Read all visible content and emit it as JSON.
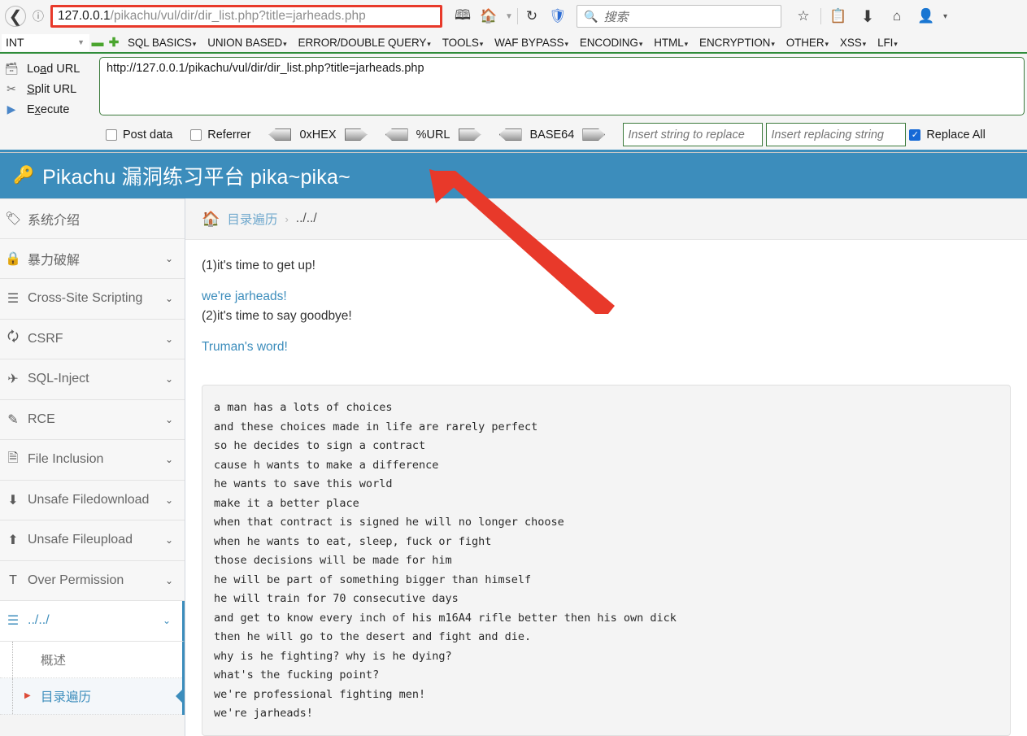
{
  "browser": {
    "back_icon": "back-arrow-icon",
    "info_icon": "page-info-icon",
    "url_host": "127.0.0.1",
    "url_path": "/pikachu/vul/dir/dir_list.php?title=jarheads.php",
    "reader_icon": "reader-view-icon",
    "home_icon": "home-icon",
    "dropdown_icon": "chevron-down-icon",
    "reload_icon": "reload-icon",
    "shield_icon": "tracking-protection-icon",
    "search_icon": "search-icon",
    "search_placeholder": "搜索",
    "bookmark_icon": "star-icon",
    "library_icon": "library-icon",
    "download_icon": "download-icon",
    "home2_icon": "home-page-icon",
    "account_icon": "account-avatar-icon",
    "account_caret": "caret-down-icon"
  },
  "hackbar": {
    "type_select": "INT",
    "minus_label": "–",
    "plus_label": "+",
    "menu": [
      "SQL BASICS",
      "UNION BASED",
      "ERROR/DOUBLE QUERY",
      "TOOLS",
      "WAF BYPASS",
      "ENCODING",
      "HTML",
      "ENCRYPTION",
      "OTHER",
      "XSS",
      "LFI"
    ],
    "actions": [
      {
        "label_pre": "Lo",
        "label_u": "a",
        "label_post": "d URL",
        "icon": "load-url-icon"
      },
      {
        "label_pre": "",
        "label_u": "S",
        "label_post": "plit URL",
        "icon": "split-url-icon"
      },
      {
        "label_pre": "E",
        "label_u": "x",
        "label_post": "ecute",
        "icon": "execute-icon"
      }
    ],
    "url_value": "http://127.0.0.1/pikachu/vul/dir/dir_list.php?title=jarheads.php",
    "post_data_label": "Post data",
    "referrer_label": "Referrer",
    "hex_label": "0xHEX",
    "url_encode_label": "%URL",
    "base64_label": "BASE64",
    "search_replace_placeholder": "Insert string to replace",
    "replacing_placeholder": "Insert replacing string",
    "replace_all_label": "Replace All"
  },
  "pikachu": {
    "logo_icon": "magnifier-key-icon",
    "title": "Pikachu 漏洞练习平台 pika~pika~",
    "header_color": "#3c8dbc",
    "sidebar": [
      {
        "label": "系统介绍",
        "icon": "tag-icon",
        "chevron": ""
      },
      {
        "label": "暴力破解",
        "icon": "lock-icon",
        "chevron": "⌄"
      },
      {
        "label": "Cross-Site Scripting",
        "icon": "xss-icon",
        "chevron": "⌄"
      },
      {
        "label": "CSRF",
        "icon": "external-link-icon",
        "chevron": "⌄"
      },
      {
        "label": "SQL-Inject",
        "icon": "plane-icon",
        "chevron": "⌄"
      },
      {
        "label": "RCE",
        "icon": "pencil-icon",
        "chevron": "⌄"
      },
      {
        "label": "File Inclusion",
        "icon": "file-icon",
        "chevron": "⌄"
      },
      {
        "label": "Unsafe Filedownload",
        "icon": "download-circle-icon",
        "chevron": "⌄"
      },
      {
        "label": "Unsafe Fileupload",
        "icon": "upload-circle-icon",
        "chevron": "⌄"
      },
      {
        "label": "Over Permission",
        "icon": "text-height-icon",
        "chevron": "⌄"
      },
      {
        "label": "../../",
        "icon": "list-icon",
        "chevron": "⌄"
      }
    ],
    "sidebar_sub": [
      {
        "label": "概述",
        "active": false
      },
      {
        "label": "目录遍历",
        "active": true
      }
    ],
    "breadcrumb": {
      "home_icon": "home-icon",
      "link": "目录遍历",
      "separator": "›",
      "current": "../../"
    },
    "content_lines": [
      {
        "text": "(1)it's time to get up!",
        "style": "plain"
      },
      {
        "text": "",
        "style": "gap"
      },
      {
        "text": "we're jarheads!",
        "style": "blue"
      },
      {
        "text": "(2)it's time to say goodbye!",
        "style": "plain"
      },
      {
        "text": "",
        "style": "gap"
      },
      {
        "text": "Truman's word!",
        "style": "blue"
      }
    ],
    "poem": "a man has a lots of choices\nand these choices made in life are rarely perfect\nso he decides to sign a contract\ncause h wants to make a difference\nhe wants to save this world\nmake it a better place\nwhen that contract is signed he will no longer choose\nwhen he wants to eat, sleep, fuck or fight\nthose decisions will be made for him\nhe will be part of something bigger than himself\nhe will train for 70 consecutive days\nand get to know every inch of his m16A4 rifle better then his own dick\nthen he will go to the desert and fight and die.\nwhy is he fighting? why is he dying?\nwhat's the fucking point?\nwe're professional fighting men!\nwe're jarheads!"
  },
  "annotation": {
    "arrow_color": "#e8392a",
    "highlight_color": "#e8392a"
  }
}
